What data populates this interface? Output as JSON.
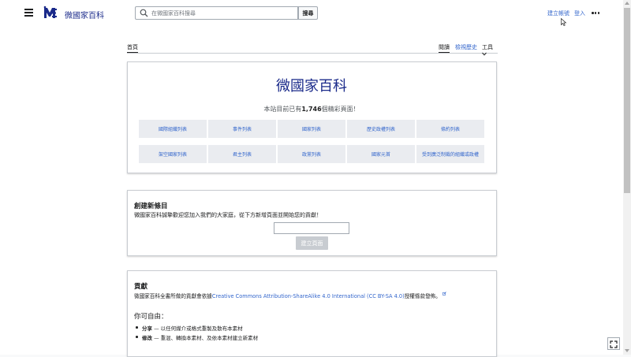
{
  "header": {
    "site_name": "微國家百科",
    "search_placeholder": "在微國家百科搜尋",
    "search_button": "搜尋",
    "create_account": "建立帳號",
    "login": "登入"
  },
  "tabs": {
    "home": "首頁",
    "read": "閱讀",
    "history": "檢視歷史",
    "tools": "工具"
  },
  "hero": {
    "title": "微國家百科",
    "stats_prefix": "本站目前已有",
    "stats_count": "1,746",
    "stats_suffix": "個精彩頁面！"
  },
  "links": [
    "國際組織列表",
    "事件列表",
    "國家列表",
    "歷史政權列表",
    "條約列表",
    "架空國家列表",
    "君主列表",
    "政黨列表",
    "國家元首",
    "受到廣泛制裁的組織或政權"
  ],
  "create": {
    "heading": "創建新條目",
    "text": "微國家百科誠摯歡迎您加入我們的大家庭，從下方新增頁面並開始您的貢獻！",
    "button": "建立頁面"
  },
  "contribute": {
    "heading": "貢獻",
    "text_prefix": "微國家百科全書所做的貢獻會依據",
    "license_link": "Creative Commons Attribution-ShareAlike 4.0 International (CC BY-SA 4.0)",
    "text_suffix": "授權條款發佈。",
    "freedom_heading": "你可自由：",
    "items": [
      {
        "term": "分享",
        "desc": "— 以任何媒介或格式重製及散布本素材"
      },
      {
        "term": "修改",
        "desc": "— 重混、轉換本素材、及依本素材建立新素材"
      }
    ]
  },
  "colors": {
    "accent_link": "#3366cc",
    "title_blue": "#1a2a8a"
  },
  "icons": [
    "menu-icon",
    "site-logo-icon",
    "search-icon",
    "more-icon",
    "chevron-down-icon",
    "fullscreen-icon"
  ]
}
